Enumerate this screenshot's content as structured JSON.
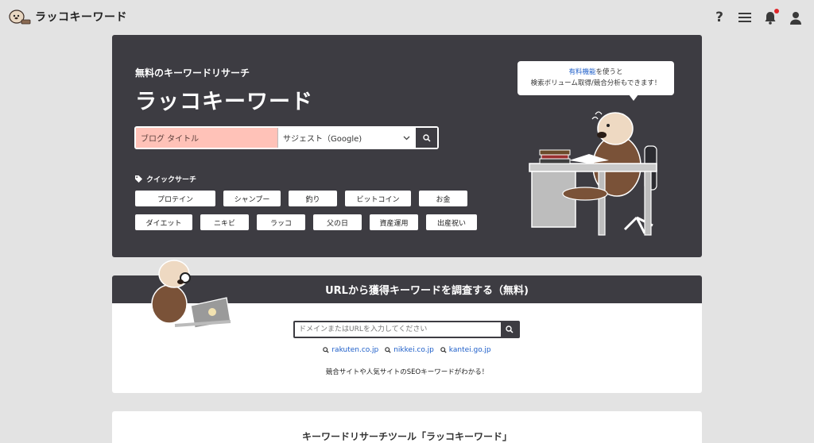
{
  "header": {
    "logo_text": "ラッコキーワード",
    "icons": [
      "help-icon",
      "menu-icon",
      "bell-icon",
      "user-icon"
    ],
    "help_glyph": "?"
  },
  "hero": {
    "subtitle": "無料のキーワードリサーチ",
    "title": "ラッコキーワード",
    "search": {
      "value": "ブログ タイトル",
      "placeholder": "",
      "mode": "サジェスト（Google)"
    },
    "quick_search_label": "クイックサーチ",
    "quick_search": [
      "プロテイン",
      "シャンプー",
      "釣り",
      "ビットコイン",
      "お金",
      "ダイエット",
      "ニキビ",
      "ラッコ",
      "父の日",
      "資産運用",
      "出産祝い"
    ],
    "bubble": {
      "link": "有料機能",
      "line1_rest": "を使うと",
      "line2": "検索ボリューム取得/競合分析もできます！"
    }
  },
  "url_section": {
    "title": "URLから獲得キーワードを調査する（無料)",
    "placeholder": "ドメインまたはURLを入力してください",
    "examples": [
      "rakuten.co.jp",
      "nikkei.co.jp",
      "kantei.go.jp"
    ],
    "description": "競合サイトや人気サイトのSEOキーワードがわかる！"
  },
  "bottom": {
    "title": "キーワードリサーチツール「ラッコキーワード」"
  },
  "colors": {
    "dark_panel": "#3d3c42",
    "input_highlight": "#ffc2b8",
    "link": "#1d5ec9",
    "notification": "#e0262a"
  }
}
